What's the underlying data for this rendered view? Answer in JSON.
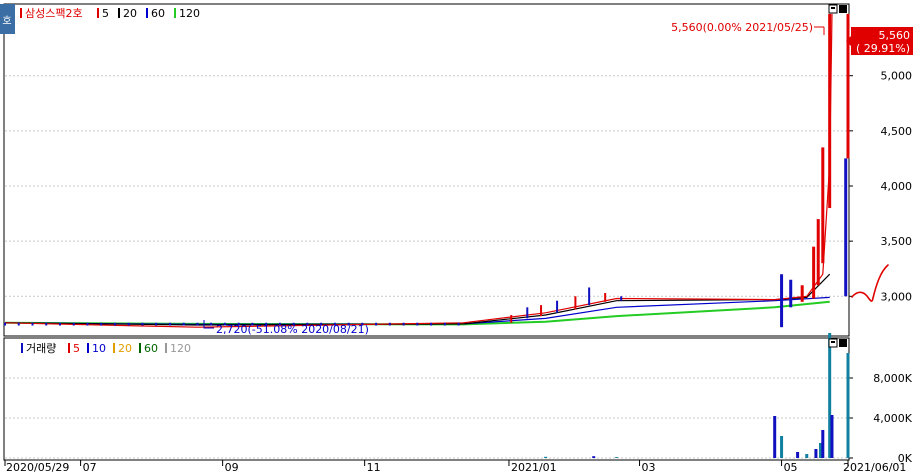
{
  "price_panel": {
    "badge_label": "호",
    "legend_name": "삼성스팩2호",
    "legend_mas": [
      {
        "label": "5",
        "color": "#e00000"
      },
      {
        "label": "20",
        "color": "#000000"
      },
      {
        "label": "60",
        "color": "#0000cc"
      },
      {
        "label": "120",
        "color": "#22cc22"
      }
    ],
    "high_annotation": "5,560(0.00% 2021/05/25)",
    "low_annotation": "2,720(-51.08% 2020/08/21)",
    "last_price_label": "5,560",
    "last_change_label": "( 29.91%)"
  },
  "volume_panel": {
    "legend_name": "거래량",
    "legend_mas": [
      {
        "label": "5",
        "color": "#e00000"
      },
      {
        "label": "10",
        "color": "#0000cc"
      },
      {
        "label": "20",
        "color": "#e0a000"
      },
      {
        "label": "60",
        "color": "#006600"
      },
      {
        "label": "120",
        "color": "#999999"
      }
    ]
  },
  "colors": {
    "up": "#e00000",
    "down": "#1010c0",
    "ma5": "#e00000",
    "ma20": "#000000",
    "ma60": "#0000cc",
    "ma120": "#22cc22",
    "frame": "#000000",
    "grid": "#c8c8c8",
    "volume_up": "#1010c0",
    "volume_down": "#1080a0"
  },
  "chart_data": [
    {
      "type": "line",
      "title": "삼성스팩2호",
      "ylim": [
        2640,
        5650
      ],
      "y_ticks": [
        3000,
        3500,
        4000,
        4500,
        5000
      ],
      "y_tick_labels": [
        "3,000",
        "3,500",
        "4,000",
        "4,500",
        "5,000"
      ],
      "x_tick_labels": [
        "2020/05/29",
        "07",
        "09",
        "11",
        "2021/01",
        "03",
        "05",
        "2021/06/01"
      ],
      "grid": true,
      "series": [
        {
          "name": "5",
          "x": [
            "2020/05/29",
            "2020/08/21",
            "2020/12/15",
            "2021/01/20",
            "2021/02/20",
            "2021/04/30",
            "2021/05/14",
            "2021/05/21",
            "2021/05/24",
            "2021/05/25"
          ],
          "values": [
            2760,
            2720,
            2760,
            2850,
            2980,
            2970,
            3000,
            3200,
            4200,
            5560
          ]
        },
        {
          "name": "20",
          "x": [
            "2020/05/29",
            "2020/08/21",
            "2020/12/15",
            "2021/01/20",
            "2021/02/20",
            "2021/04/30",
            "2021/05/14",
            "2021/05/24"
          ],
          "values": [
            2760,
            2740,
            2750,
            2830,
            2960,
            2970,
            2990,
            3200
          ]
        },
        {
          "name": "60",
          "x": [
            "2020/05/29",
            "2020/08/21",
            "2020/12/15",
            "2021/01/20",
            "2021/02/20",
            "2021/04/30",
            "2021/05/24"
          ],
          "values": [
            2760,
            2745,
            2750,
            2800,
            2900,
            2960,
            2990
          ]
        },
        {
          "name": "120",
          "x": [
            "2020/05/29",
            "2020/08/21",
            "2020/12/15",
            "2021/01/20",
            "2021/02/20",
            "2021/04/30",
            "2021/05/24"
          ],
          "values": [
            2760,
            2750,
            2745,
            2770,
            2820,
            2900,
            2950
          ]
        }
      ],
      "annotations": [
        {
          "text": "5,560(0.00% 2021/05/25)",
          "x": "2021/05/25",
          "y": 5560
        },
        {
          "text": "2,720(-51.08% 2020/08/21)",
          "x": "2020/08/21",
          "y": 2720
        }
      ],
      "last_value": 5560,
      "last_change_pct": 29.91
    },
    {
      "type": "bar",
      "title": "거래량",
      "ylim": [
        0,
        12000000
      ],
      "y_ticks": [
        0,
        4000000,
        8000000
      ],
      "y_tick_labels": [
        "0K",
        "4,000K",
        "8,000K"
      ],
      "grid": true,
      "categories": [
        "2021/01/20",
        "2021/02/10",
        "2021/02/20",
        "2021/04/30",
        "2021/05/03",
        "2021/05/10",
        "2021/05/14",
        "2021/05/18",
        "2021/05/20",
        "2021/05/21",
        "2021/05/24",
        "2021/05/25",
        "2021/06/01"
      ],
      "values": [
        120000,
        180000,
        90000,
        4200000,
        2200000,
        600000,
        400000,
        900000,
        1500000,
        2800000,
        12500000,
        4300000,
        10500000
      ]
    }
  ]
}
